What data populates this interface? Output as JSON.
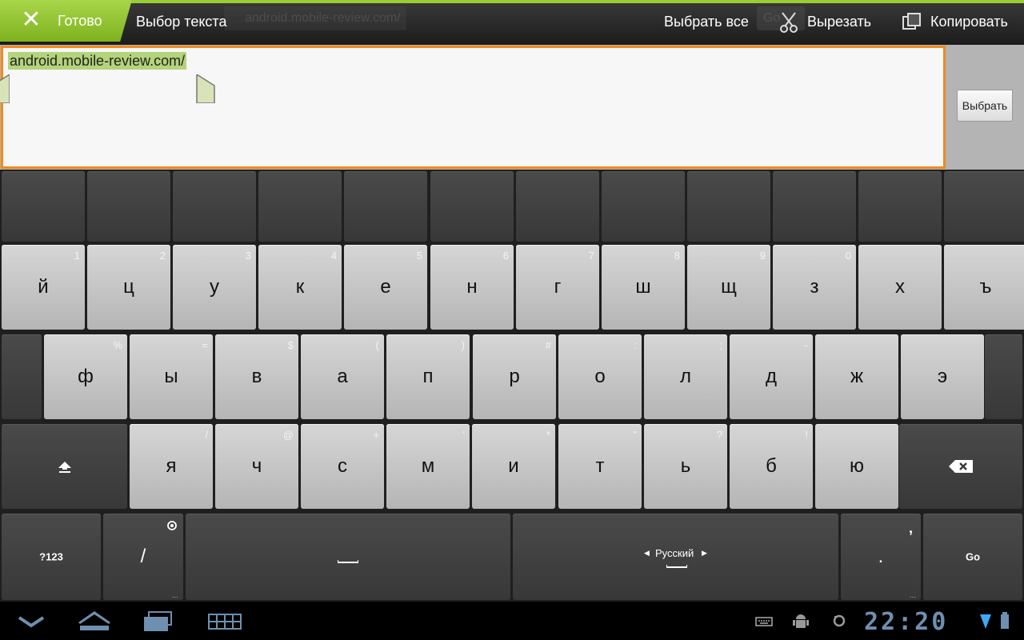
{
  "action_bar": {
    "done_label": "Готово",
    "title": "Выбор текста",
    "select_all_label": "Выбрать все",
    "cut_label": "Вырезать",
    "copy_label": "Копировать",
    "background_url_ghost": "android.mobile-review.com/",
    "background_go_ghost": "Go"
  },
  "text_field": {
    "value": "android.mobile-review.com/",
    "select_button_label": "Выбрать"
  },
  "keyboard": {
    "row1": [
      {
        "label": "й",
        "hint": "1"
      },
      {
        "label": "ц",
        "hint": "2"
      },
      {
        "label": "у",
        "hint": "3"
      },
      {
        "label": "к",
        "hint": "4"
      },
      {
        "label": "е",
        "hint": "5"
      },
      {
        "label": "н",
        "hint": "6"
      },
      {
        "label": "г",
        "hint": "7"
      },
      {
        "label": "ш",
        "hint": "8"
      },
      {
        "label": "щ",
        "hint": "9"
      },
      {
        "label": "з",
        "hint": "0"
      },
      {
        "label": "х",
        "hint": ""
      },
      {
        "label": "ъ",
        "hint": ""
      }
    ],
    "row2": [
      {
        "label": "ф",
        "hint": "%"
      },
      {
        "label": "ы",
        "hint": "="
      },
      {
        "label": "в",
        "hint": "$"
      },
      {
        "label": "а",
        "hint": "("
      },
      {
        "label": "п",
        "hint": ")"
      },
      {
        "label": "р",
        "hint": "#"
      },
      {
        "label": "о",
        "hint": ":"
      },
      {
        "label": "л",
        "hint": ";"
      },
      {
        "label": "д",
        "hint": "-"
      },
      {
        "label": "ж",
        "hint": ""
      },
      {
        "label": "э",
        "hint": ""
      }
    ],
    "row3": [
      {
        "label": "я",
        "hint": "/"
      },
      {
        "label": "ч",
        "hint": "@"
      },
      {
        "label": "с",
        "hint": "+"
      },
      {
        "label": "м",
        "hint": "'"
      },
      {
        "label": "и",
        "hint": "*"
      },
      {
        "label": "т",
        "hint": "\""
      },
      {
        "label": "ь",
        "hint": "?"
      },
      {
        "label": "б",
        "hint": "!"
      },
      {
        "label": "ю",
        "hint": ""
      }
    ],
    "symbols_label": "?123",
    "slash_label": "/",
    "space_left_label": "_",
    "language_label": "Русский",
    "period_label": ".",
    "comma_hint": ",",
    "go_label": "Go",
    "settings_icon": "settings-gear-icon",
    "shift_icon": "shift-arrow-icon",
    "delete_icon": "backspace-icon"
  },
  "system_bar": {
    "clock": "22:20",
    "accent_color": "#6f8fb0",
    "icons": [
      "back-chevron-icon",
      "home-icon",
      "recent-apps-icon",
      "keyboard-grid-icon",
      "keyboard-status-icon",
      "android-debug-icon",
      "sync-icon",
      "wifi-icon",
      "battery-icon"
    ]
  }
}
